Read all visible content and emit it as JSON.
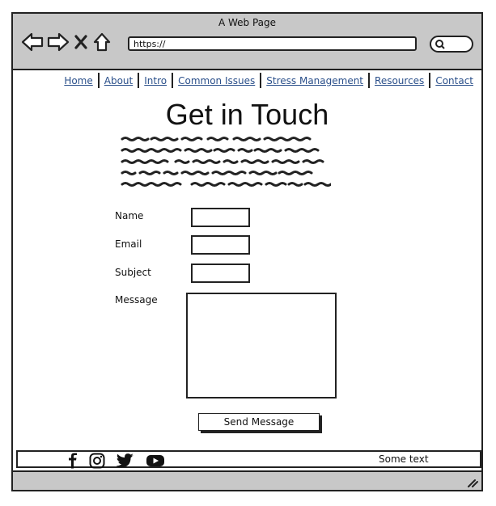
{
  "window": {
    "title": "A Web Page"
  },
  "browser": {
    "url": "https://"
  },
  "nav": [
    "Home",
    "About",
    "Intro",
    "Common Issues",
    "Stress Management",
    "Resources",
    "Contact"
  ],
  "page": {
    "heading": "Get in Touch"
  },
  "form": {
    "name_label": "Name",
    "email_label": "Email",
    "subject_label": "Subject",
    "message_label": "Message",
    "send_label": "Send Message"
  },
  "footer": {
    "social_icons": [
      "facebook-icon",
      "instagram-icon",
      "twitter-icon",
      "youtube-icon"
    ],
    "text": "Some text"
  },
  "colors": {
    "chrome": "#c8c8c8",
    "link": "#2a4f8a",
    "border": "#222222"
  }
}
